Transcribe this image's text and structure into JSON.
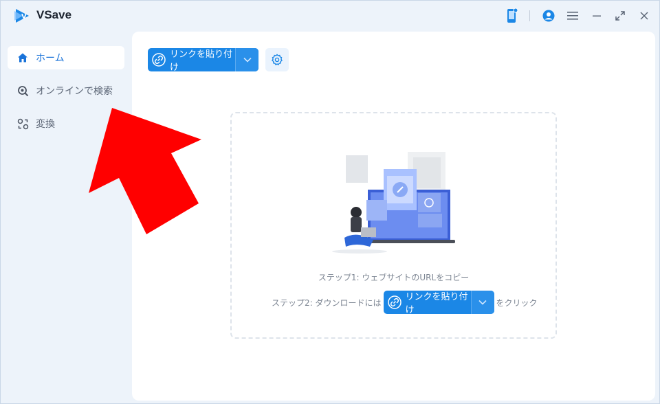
{
  "app": {
    "title": "VSave"
  },
  "titlebar": {
    "icons": [
      "phone-icon",
      "account-icon",
      "menu-icon",
      "minimize-icon",
      "maximize-icon",
      "close-icon"
    ]
  },
  "sidebar": {
    "items": [
      {
        "label": "ホーム",
        "icon": "home-icon",
        "active": true
      },
      {
        "label": "オンラインで検索",
        "icon": "search-online-icon",
        "active": false
      },
      {
        "label": "変換",
        "icon": "convert-icon",
        "active": false
      }
    ]
  },
  "toolbar": {
    "paste_label": "リンクを貼り付け",
    "settings_icon": "gear-icon"
  },
  "dropzone": {
    "step1": "ステップ1: ウェブサイトのURLをコピー",
    "step2_prefix": "ステップ2: ダウンロードには",
    "step2_button": "リンクを貼り付け",
    "step2_suffix": "をクリック"
  },
  "colors": {
    "accent": "#1b87e6",
    "annotation_arrow": "#ff0000"
  }
}
